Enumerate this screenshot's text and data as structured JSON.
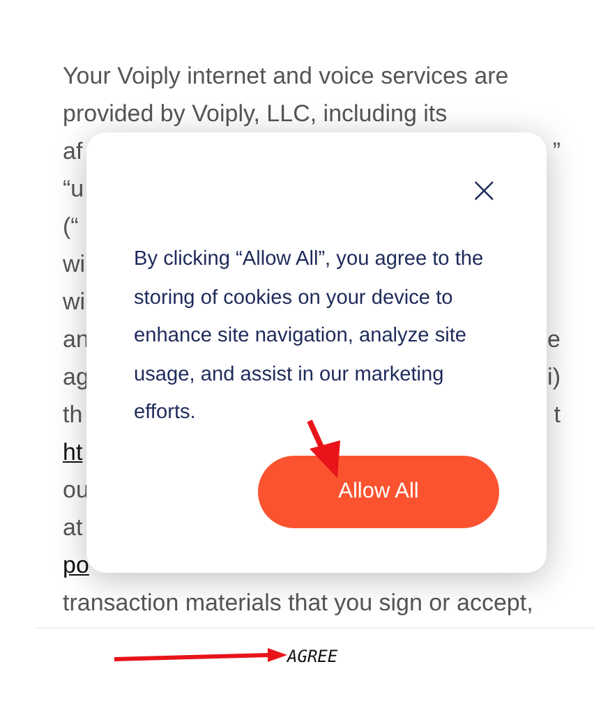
{
  "paragraph_lines": [
    {
      "left": "Your Voiply internet and voice services are",
      "link": false
    },
    {
      "left": "provided by Voiply, LLC, including its",
      "link": false
    },
    {
      "left": "af",
      "right": "”",
      "link": false
    },
    {
      "left": "“u",
      "link": false
    },
    {
      "left": "(“",
      "link": false
    },
    {
      "left": "wi",
      "link": false
    },
    {
      "left": "wi",
      "link": false
    },
    {
      "left": "an",
      "right": "e",
      "link": false
    },
    {
      "left": "ag",
      "right": "i)",
      "link": false
    },
    {
      "left": "th",
      "right": "t",
      "link": false
    },
    {
      "left": "ht",
      "link": true
    },
    {
      "left": "ou",
      "link": false
    },
    {
      "left": "at",
      "link": false
    },
    {
      "left": "po",
      "link": true
    },
    {
      "left": "transaction materials that you sign or accept,",
      "link": false
    }
  ],
  "cookie_dialog": {
    "close": "×",
    "message": "By clicking “Allow All”, you agree to the storing of cookies on your device to enhance site navigation, analyze site usage, and assist in our marketing efforts.",
    "button": "Allow All"
  },
  "annotation": {
    "label": "AGREE"
  }
}
